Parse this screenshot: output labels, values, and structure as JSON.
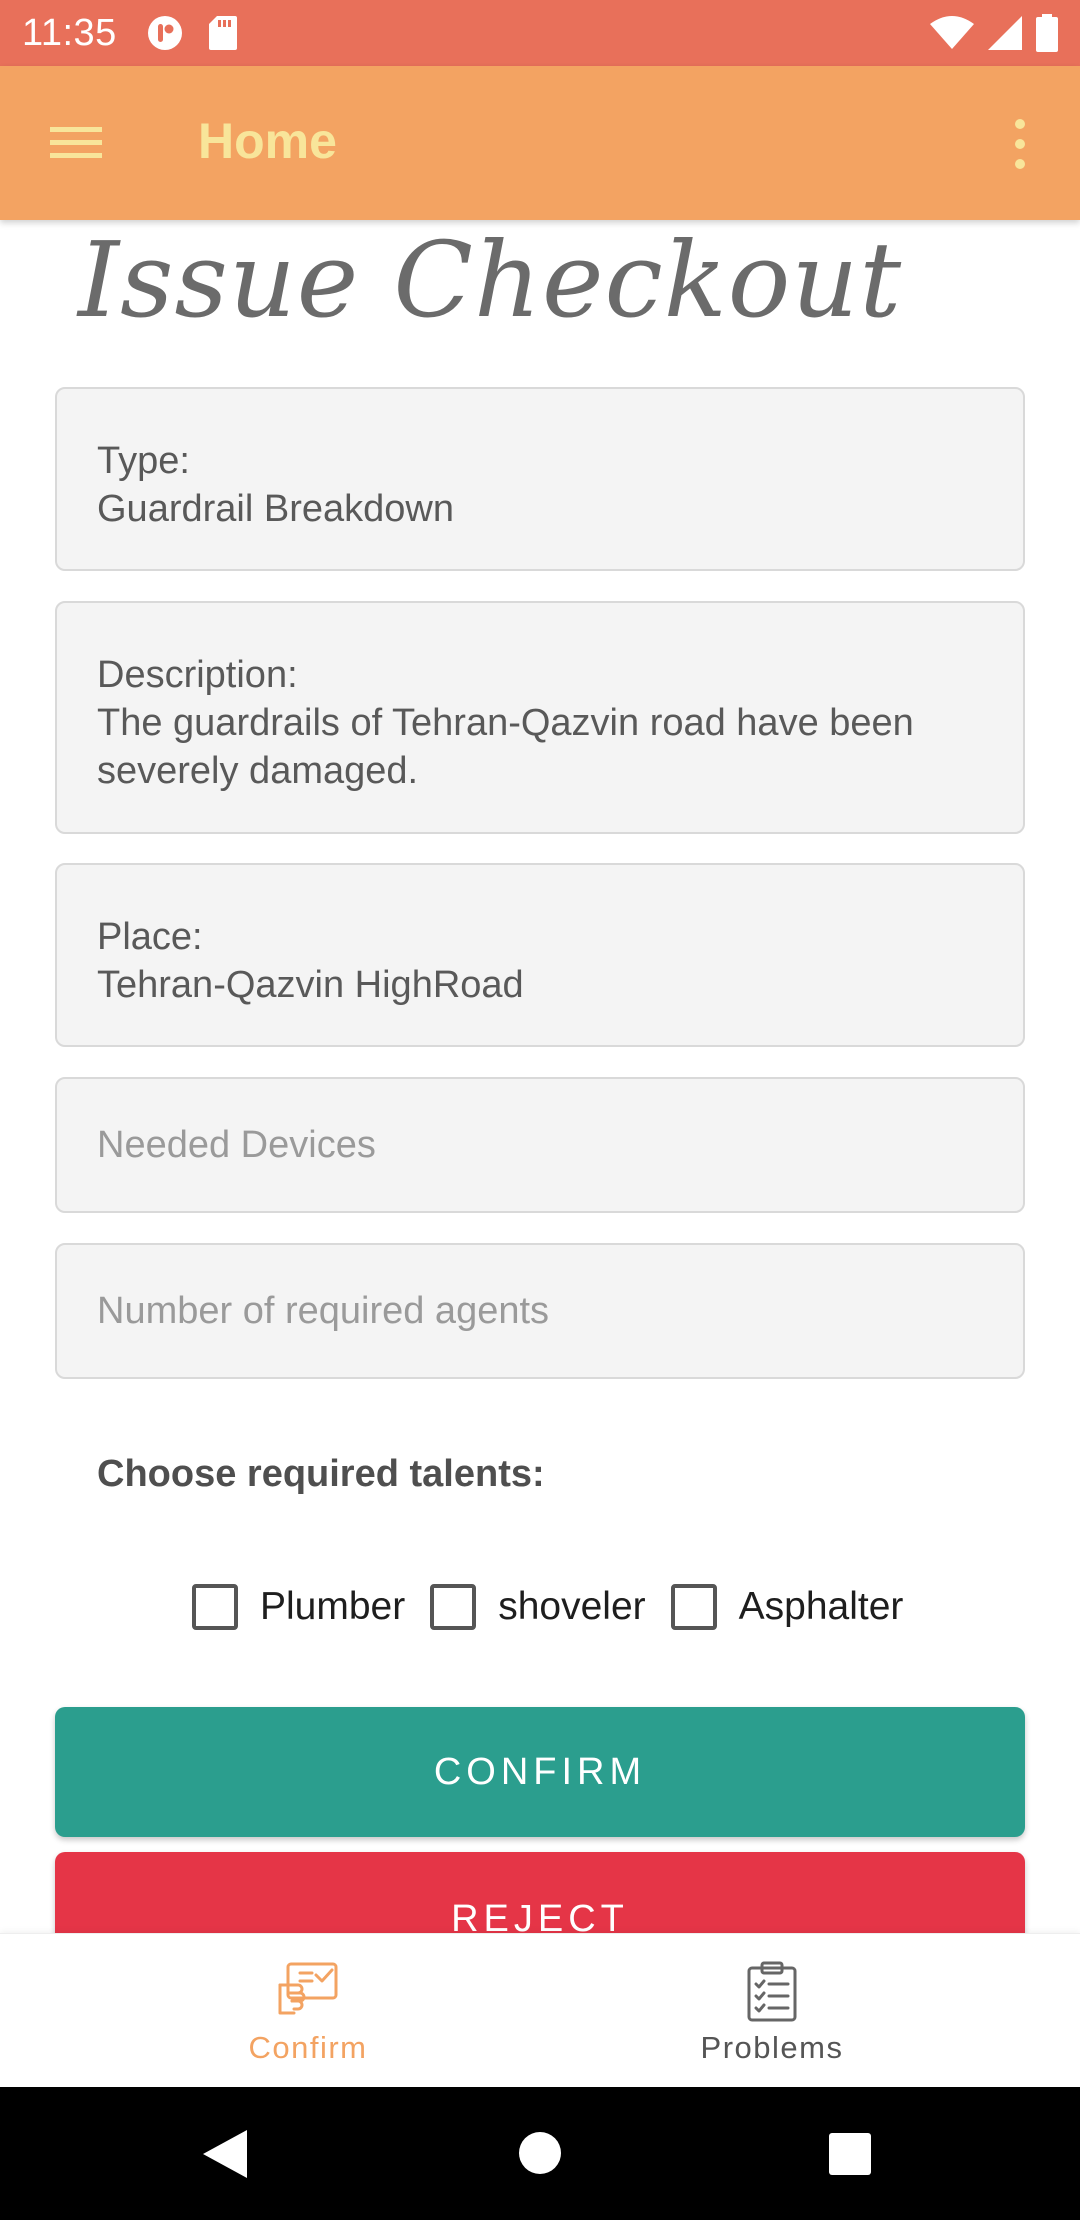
{
  "status_bar": {
    "time": "11:35"
  },
  "app_bar": {
    "title": "Home",
    "menu_icon": "hamburger-menu-icon",
    "overflow_icon": "more-vert-icon"
  },
  "page": {
    "heading": "Issue Checkout"
  },
  "issue": {
    "type_label": "Type:",
    "type_value": "Guardrail Breakdown",
    "description_label": "Description:",
    "description_value": "The guardrails of Tehran-Qazvin road have been severely damaged.",
    "place_label": "Place:",
    "place_value": "Tehran-Qazvin HighRoad"
  },
  "form": {
    "devices_placeholder": "Needed Devices",
    "agents_placeholder": "Number of required agents",
    "talents_label": "Choose required talents:",
    "talents": [
      {
        "label": "Plumber",
        "checked": false
      },
      {
        "label": "shoveler",
        "checked": false
      },
      {
        "label": "Asphalter",
        "checked": false
      }
    ]
  },
  "actions": {
    "confirm_label": "CONFIRM",
    "reject_label": "REJECT"
  },
  "bottom_nav": {
    "items": [
      {
        "label": "Confirm",
        "icon": "confirm-hand-icon",
        "active": true
      },
      {
        "label": "Problems",
        "icon": "clipboard-checklist-icon",
        "active": false
      }
    ]
  },
  "colors": {
    "status_bar": "#e8705a",
    "app_bar": "#f3a362",
    "title_text": "#f8e59a",
    "confirm": "#2b9e8e",
    "reject": "#e53547",
    "nav_active": "#f3a362"
  }
}
